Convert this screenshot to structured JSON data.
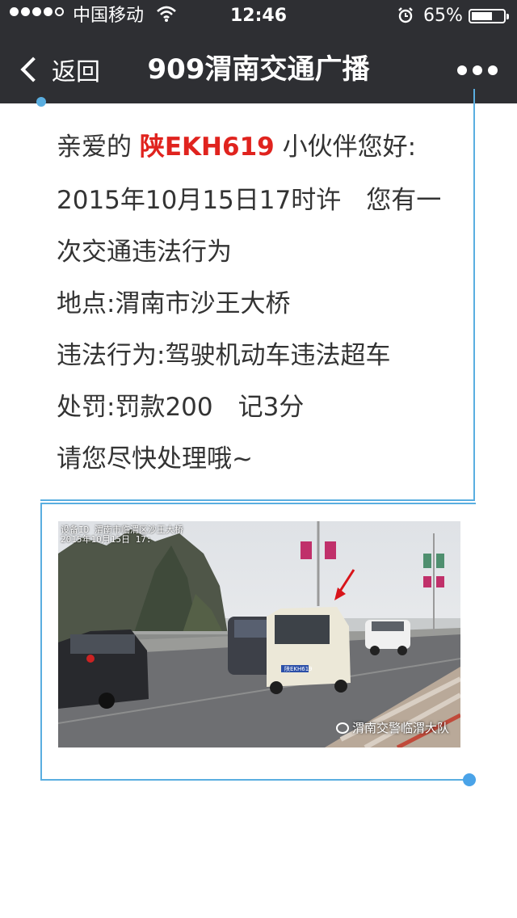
{
  "status_bar": {
    "carrier": "中国移动",
    "time": "12:46",
    "battery": "65%",
    "battery_level": 0.65
  },
  "nav": {
    "back_label": "返回",
    "title": "909渭南交通广播"
  },
  "article": {
    "greeting_prefix": "亲爱的 ",
    "plate": "陕EKH619",
    "greeting_suffix": " 小伙伴您好:",
    "line2": "2015年10月15日17时许　您有一",
    "line3": "次交通违法行为",
    "line4": "地点:渭南市沙王大桥",
    "line5": "违法行为:驾驶机动车违法超车",
    "line6": "处罚:罚款200　记3分",
    "line7": "请您尽快处理哦~"
  },
  "photo": {
    "overlay_line1": "设备ID  渭南市临渭区沙王大桥",
    "overlay_line2": "2015年10月15日 17:",
    "plate_label": "陕EKH619",
    "watermark": "渭南交警临渭大队",
    "colors": {
      "sky": "#e4e6e8",
      "road": "#6e6f72",
      "van": "#ece8d8",
      "arrow": "#d8141a"
    }
  },
  "colors": {
    "topbar": "#2e2f33",
    "accent_blue": "#5aaee0",
    "plate_red": "#e0231e",
    "text": "#333333"
  }
}
